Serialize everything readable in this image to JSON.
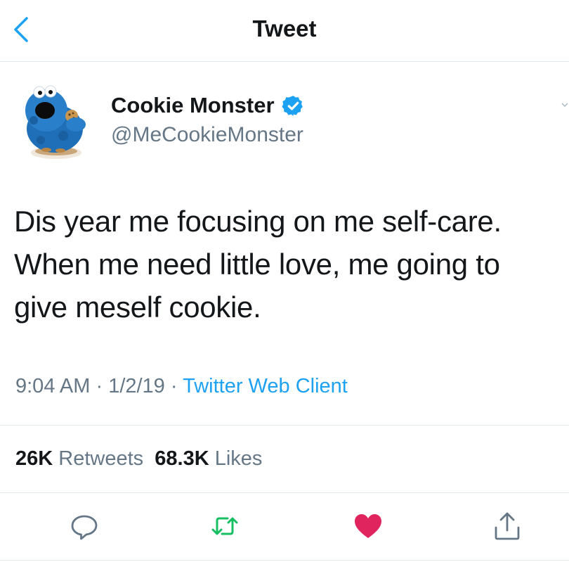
{
  "nav": {
    "title": "Tweet"
  },
  "tweet": {
    "author": {
      "name": "Cookie Monster",
      "handle": "@MeCookieMonster",
      "verified": true
    },
    "text_lines": [
      "Dis year me focusing on me self-care.",
      "When me need little love, me going to",
      "give meself cookie."
    ],
    "meta": {
      "time": "9:04 AM",
      "separator": " · ",
      "date": "1/2/19",
      "client": "Twitter Web Client"
    },
    "stats": {
      "retweets_count": "26K",
      "retweets_label": "Retweets",
      "likes_count": "68.3K",
      "likes_label": "Likes"
    },
    "liked": true
  },
  "colors": {
    "accent": "#1da1f2",
    "retweet": "#17bf63",
    "like": "#e0245e",
    "secondary_text": "#657786",
    "primary_text": "#14171a",
    "divider": "#e1e8ed"
  },
  "icons": {
    "back": "chevron-left-icon",
    "verified": "verified-badge-icon",
    "reply": "reply-icon",
    "retweet": "retweet-icon",
    "like": "heart-icon",
    "share": "share-icon"
  }
}
